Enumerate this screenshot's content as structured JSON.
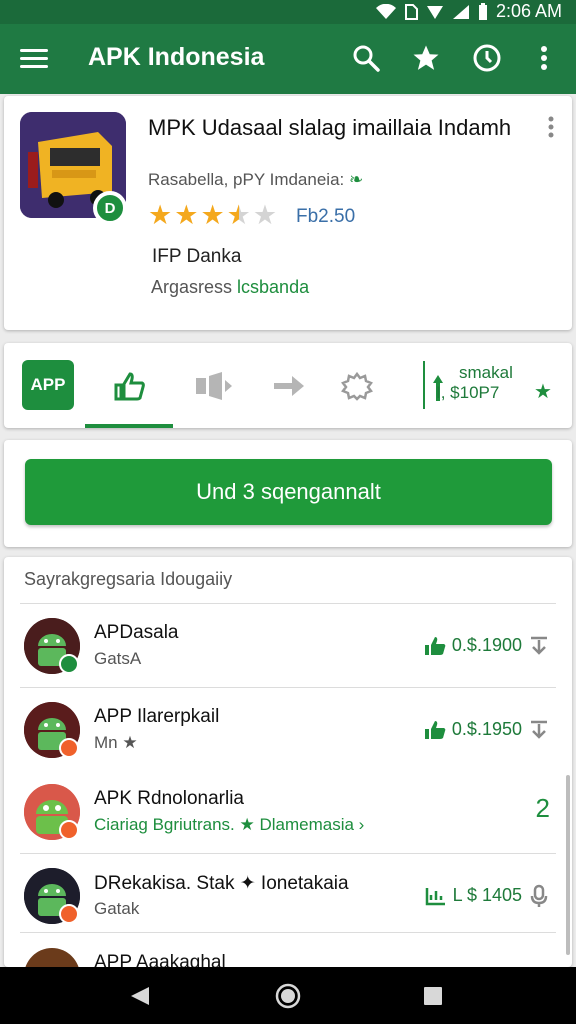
{
  "status_bar": {
    "time": "2:06 AM",
    "icons": [
      "wifi-icon",
      "sim-icon",
      "signal-icon",
      "signal-x-icon",
      "battery-icon"
    ]
  },
  "app_bar": {
    "title": "APK Indonesia",
    "actions": [
      "search-icon",
      "star-icon",
      "history-icon",
      "more-vert-icon"
    ]
  },
  "app_detail": {
    "name": "MPK Udasaal slalag imaillaia Indamh",
    "developer": "Rasabella, pPY Imdaneia:",
    "rating_stars": 3.5,
    "rating_max": 5,
    "rating_text": "Fb2.50",
    "publisher": "IFP Danka",
    "category_prefix": "Argasress ",
    "category_link": "lcsbanda",
    "badge": "D"
  },
  "tabs": {
    "logo_label": "APP",
    "items": [
      "tab-thumbs-up-icon",
      "tab-audio-icon",
      "tab-arrow-icon",
      "tab-gear-icon"
    ],
    "active_index": 0,
    "side_title": "smakal",
    "side_value": "I, $10P7"
  },
  "install": {
    "label": "Und 3 sqengannalt"
  },
  "list": {
    "header": "Sayrakgregsaria Idougaiiy",
    "rows": [
      {
        "name": "APDasala",
        "sub": "GatsA",
        "value": "0.$.1900"
      },
      {
        "name": "APP Ilarerpkail",
        "sub": "Mn ★",
        "value": "0.$.1950"
      },
      {
        "name": "APK Rdnolonarlia",
        "sub": "Ciariag Bgriutrans. ★ Dlamemasia ›",
        "value": "2"
      },
      {
        "name": "DRekakisa. Stak ✦ Ionetakaia",
        "sub": "Gatak",
        "value": "L $ 1405"
      },
      {
        "name": "APP Aaakaghal",
        "sub": "",
        "value": ""
      }
    ]
  },
  "colors": {
    "status_bar": "#1b6a3a",
    "app_bar": "#1f7a43",
    "accent": "#1e8e3e",
    "star": "#f4a81d"
  }
}
